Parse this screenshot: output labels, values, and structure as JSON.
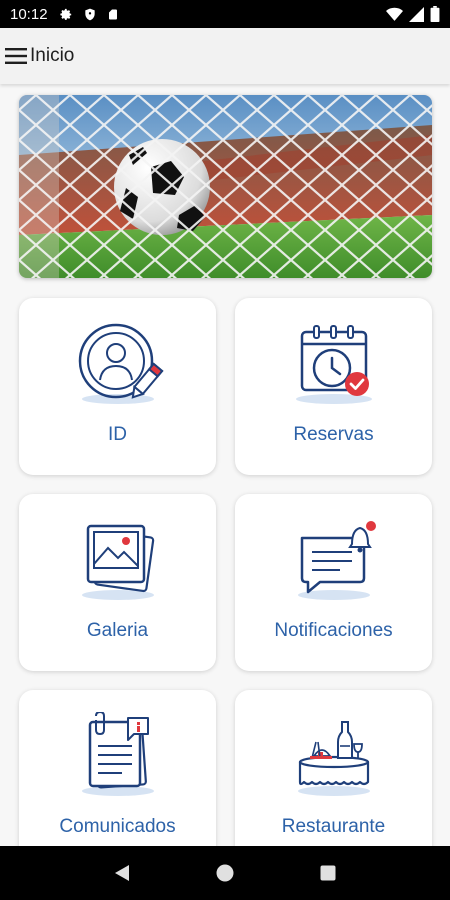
{
  "status_bar": {
    "time": "10:12",
    "icons": [
      "gear-icon",
      "shield-icon",
      "sim-card-icon",
      "wifi-icon",
      "signal-icon",
      "battery-icon"
    ]
  },
  "app_bar": {
    "title": "Inicio",
    "menu_icon": "hamburger-menu-icon"
  },
  "banner": {
    "image": "soccer-ball-in-goal-net"
  },
  "tiles": [
    {
      "label": "ID",
      "icon": "user-profile-edit-icon"
    },
    {
      "label": "Reservas",
      "icon": "calendar-clock-check-icon"
    },
    {
      "label": "Galeria",
      "icon": "photo-gallery-icon"
    },
    {
      "label": "Notificaciones",
      "icon": "message-bell-icon"
    },
    {
      "label": "Comunicados",
      "icon": "clipboard-document-icon"
    },
    {
      "label": "Restaurante",
      "icon": "restaurant-table-icon"
    }
  ],
  "nav_bar": {
    "buttons": [
      "back-icon",
      "home-icon",
      "recents-icon"
    ]
  },
  "colors": {
    "accent": "#2d62a8",
    "icon_stroke": "#1f3f7a",
    "badge_red": "#e0383e",
    "app_bar_bg": "#f2f2f2"
  }
}
